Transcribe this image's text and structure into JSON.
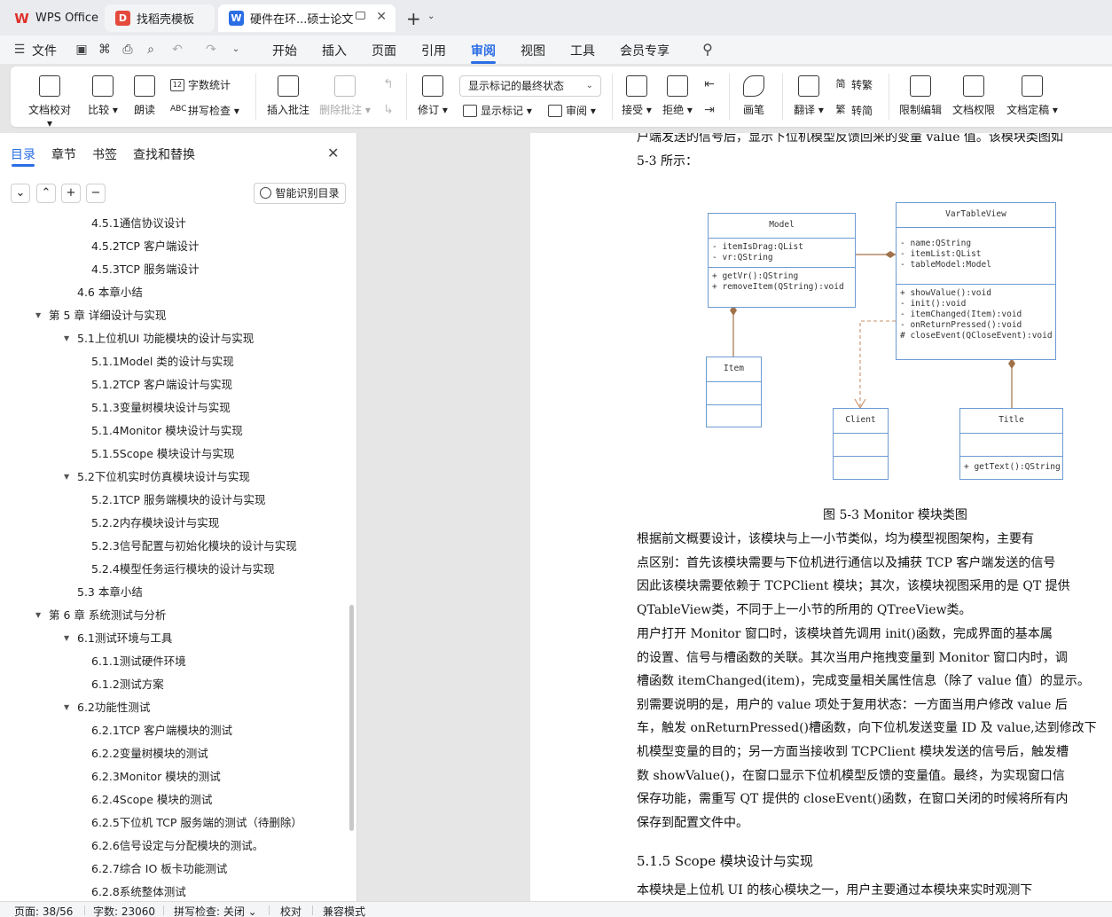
{
  "tabs": {
    "wps": "WPS Office",
    "template": "找稻壳模板",
    "doc": "硬件在环...硕士论文"
  },
  "menu": {
    "file": "文件",
    "items": [
      "开始",
      "插入",
      "页面",
      "引用",
      "审阅",
      "视图",
      "工具",
      "会员专享"
    ]
  },
  "ribbon": {
    "doc_check": "文档校对",
    "compare": "比较",
    "read_aloud": "朗读",
    "word_count": "字数统计",
    "spell_check": "拼写检查",
    "insert_comment": "插入批注",
    "delete_comment": "删除批注",
    "track_changes": "修订",
    "markup_state": "显示标记的最终状态",
    "show_markup": "显示标记",
    "review": "审阅",
    "accept": "接受",
    "reject": "拒绝",
    "pen": "画笔",
    "translate": "翻译",
    "to_traditional": "转繁",
    "to_simplified": "转简",
    "restrict_edit": "限制编辑",
    "doc_permission": "文档权限",
    "doc_finalize": "文档定稿"
  },
  "nav": {
    "tabs": [
      "目录",
      "章节",
      "书签",
      "查找和替换"
    ],
    "smart_toc": "智能识别目录",
    "toc": [
      {
        "label": "4.5.1通信协议设计",
        "level": 3
      },
      {
        "label": "4.5.2TCP 客户端设计",
        "level": 3
      },
      {
        "label": "4.5.3TCP 服务端设计",
        "level": 3
      },
      {
        "label": "4.6 本章小结",
        "level": 2
      },
      {
        "label": "第 5 章 详细设计与实现",
        "level": 1
      },
      {
        "label": "5.1上位机UI 功能模块的设计与实现",
        "level": 2
      },
      {
        "label": "5.1.1Model 类的设计与实现",
        "level": 3
      },
      {
        "label": "5.1.2TCP 客户端设计与实现",
        "level": 3
      },
      {
        "label": "5.1.3变量树模块设计与实现",
        "level": 3
      },
      {
        "label": "5.1.4Monitor 模块设计与实现",
        "level": 3
      },
      {
        "label": "5.1.5Scope 模块设计与实现",
        "level": 3
      },
      {
        "label": "5.2下位机实时仿真模块设计与实现",
        "level": 2
      },
      {
        "label": "5.2.1TCP 服务端模块的设计与实现",
        "level": 3
      },
      {
        "label": "5.2.2内存模块设计与实现",
        "level": 3
      },
      {
        "label": "5.2.3信号配置与初始化模块的设计与实现",
        "level": 3
      },
      {
        "label": "5.2.4模型任务运行模块的设计与实现",
        "level": 3
      },
      {
        "label": "5.3 本章小结",
        "level": 2
      },
      {
        "label": "第 6 章 系统测试与分析",
        "level": 1
      },
      {
        "label": "6.1测试环境与工具",
        "level": 2
      },
      {
        "label": "6.1.1测试硬件环境",
        "level": 3
      },
      {
        "label": "6.1.2测试方案",
        "level": 3
      },
      {
        "label": "6.2功能性测试",
        "level": 2
      },
      {
        "label": "6.2.1TCP 客户端模块的测试",
        "level": 3
      },
      {
        "label": "6.2.2变量树模块的测试",
        "level": 3
      },
      {
        "label": "6.2.3Monitor 模块的测试",
        "level": 3
      },
      {
        "label": "6.2.4Scope 模块的测试",
        "level": 3
      },
      {
        "label": "6.2.5下位机 TCP 服务端的测试（待删除）",
        "level": 3
      },
      {
        "label": "6.2.6信号设定与分配模块的测试。",
        "level": 3
      },
      {
        "label": "6.2.7综合 IO 板卡功能测试",
        "level": 3
      },
      {
        "label": "6.2.8系统整体测试",
        "level": 3
      }
    ]
  },
  "document": {
    "top_lines": [
      "户端发送的信号后，显示下位机模型反馈回来的变量  value 值。该模块类图如",
      "5-3 所示："
    ],
    "figure_caption": "图  5-3 Monitor 模块类图",
    "uml": {
      "model": {
        "name": "Model",
        "attrs": [
          "- itemIsDrag:QList",
          "- vr:QString"
        ],
        "methods": [
          "+ getVr():QString",
          "+ removeItem(QString):void"
        ]
      },
      "vartable": {
        "name": "VarTableView",
        "attrs": [
          "- name:QString",
          "- itemList:QList",
          "- tableModel:Model"
        ],
        "methods": [
          "+ showValue():void",
          "- init():void",
          "- itemChanged(Item):void",
          "- onReturnPressed():void",
          "# closeEvent(QCloseEvent):void"
        ]
      },
      "item": {
        "name": "Item"
      },
      "client": {
        "name": "Client"
      },
      "title": {
        "name": "Title",
        "methods": [
          "+ getText():QString"
        ]
      }
    },
    "para1": [
      "    根据前文概要设计，该模块与上一小节类似，均为模型视图架构，主要有",
      "点区别：首先该模块需要与下位机进行通信以及捕获  TCP 客户端发送的信号",
      "因此该模块需要依赖于  TCPClient 模块；其次，该模块视图采用的是  QT 提供",
      "QTableView类，不同于上一小节的所用的  QTreeView类。"
    ],
    "para2": [
      "    用户打开 Monitor 窗口时，该模块首先调用  init()函数，完成界面的基本属",
      "的设置、信号与槽函数的关联。其次当用户拖拽变量到  Monitor 窗口内时，调",
      "槽函数 itemChanged(item)，完成变量相关属性信息（除了 value 值）的显示。",
      "别需要说明的是，用户的  value 项处于复用状态：一方面当用户修改  value 后",
      "车，触发  onReturnPressed()槽函数，向下位机发送变量  ID 及 value,达到修改下",
      "机模型变量的目的；另一方面当接收到  TCPClient 模块发送的信号后，触发槽",
      "数  showValue()，在窗口显示下位机模型反馈的变量值。最终，为实现窗口信",
      "保存功能，需重写  QT 提供的  closeEvent()函数，在窗口关闭的时候将所有内",
      "保存到配置文件中。"
    ],
    "section_heading": "5.1.5 Scope 模块设计与实现",
    "para3": [
      "    本模块是上位机  UI 的核心模块之一，用户主要通过本模块来实时观测下"
    ]
  },
  "status": {
    "page": "页面: 38/56",
    "words": "字数: 23060",
    "spell": "拼写检查: 关闭",
    "proof": "校对",
    "compat": "兼容模式"
  },
  "colors": {
    "accent": "#2b6de5",
    "uml_border": "#6c9bd2",
    "uml_diamond": "#a0724a"
  }
}
